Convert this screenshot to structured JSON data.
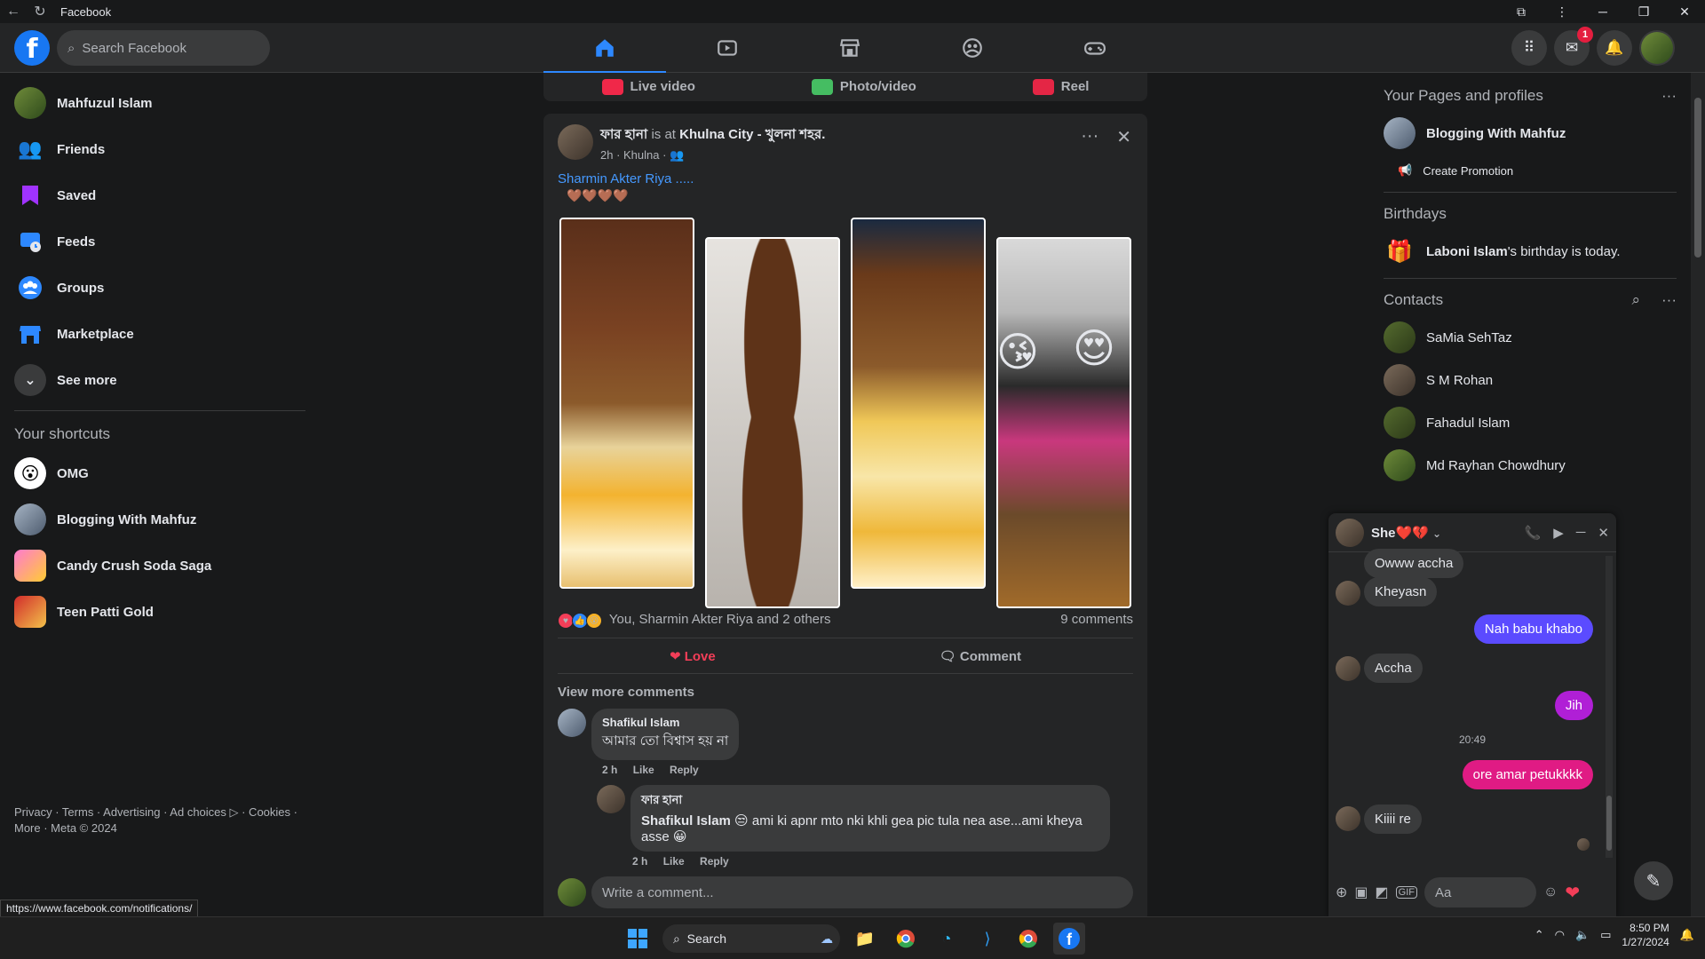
{
  "window": {
    "title": "Facebook"
  },
  "topbar": {
    "search_placeholder": "Search Facebook",
    "messenger_badge": "1"
  },
  "leftnav": {
    "items": [
      {
        "label": "Mahfuzul Islam"
      },
      {
        "label": "Friends"
      },
      {
        "label": "Saved"
      },
      {
        "label": "Feeds"
      },
      {
        "label": "Groups"
      },
      {
        "label": "Marketplace"
      },
      {
        "label": "See more"
      }
    ],
    "shortcuts_title": "Your shortcuts",
    "shortcuts": [
      {
        "label": "OMG"
      },
      {
        "label": "Blogging With Mahfuz"
      },
      {
        "label": "Candy Crush Soda Saga"
      },
      {
        "label": "Teen Patti Gold"
      }
    ],
    "footer": "Privacy · Terms · Advertising · Ad choices ▷ · Cookies · More · Meta © 2024"
  },
  "status_url": "https://www.facebook.com/notifications/",
  "composer": {
    "live": "Live video",
    "photo": "Photo/video",
    "reel": "Reel"
  },
  "post": {
    "author": "ফার হানা",
    "is_at": "is at",
    "place": "Khulna City - খুলনা শহর.",
    "meta": "2h · Khulna ·",
    "text": "Sharmin Akter Riya .....",
    "hearts": "🤎🤎🤎🤎",
    "reactions_text": "You, Sharmin Akter Riya and 2 others",
    "comments_count": "9 comments",
    "love_label": "Love",
    "comment_label": "Comment",
    "view_more": "View more comments",
    "comments": [
      {
        "name": "Shafikul Islam",
        "text": "আমার তো বিশ্বাস হয় না",
        "time": "2 h",
        "like": "Like",
        "reply": "Reply"
      },
      {
        "name": "ফার হানা",
        "mention": "Shafikul Islam",
        "text": "😒 ami ki apnr mto nki khli gea pic tula nea ase...ami kheya asse 😀",
        "time": "2 h",
        "like": "Like",
        "reply": "Reply"
      }
    ],
    "write_placeholder": "Write a comment..."
  },
  "rightcol": {
    "pages_title": "Your Pages and profiles",
    "page_name": "Blogging With Mahfuz",
    "create_promotion": "Create Promotion",
    "birthdays_title": "Birthdays",
    "birthday_name": "Laboni Islam",
    "birthday_rest": "'s birthday is today.",
    "contacts_title": "Contacts",
    "contacts": [
      {
        "name": "SaMia SehTaz"
      },
      {
        "name": "S M Rohan"
      },
      {
        "name": "Fahadul Islam"
      },
      {
        "name": "Md Rayhan Chowdhury"
      }
    ]
  },
  "chat": {
    "name": "She❤️💔",
    "messages": [
      {
        "text": "Owww accha"
      },
      {
        "text": "Kheyasn"
      },
      {
        "text": "Nah babu khabo"
      },
      {
        "text": "Accha"
      },
      {
        "text": "Jih"
      },
      {
        "text": "ore amar petukkkk"
      },
      {
        "text": "Kiiii re"
      }
    ],
    "time": "20:49",
    "input_placeholder": "Aa",
    "colors": {
      "out1": "#5b4bff",
      "out2": "#b01fd6",
      "out3": "#e01b84"
    }
  },
  "taskbar": {
    "search": "Search",
    "time": "8:50 PM",
    "date": "1/27/2024"
  }
}
